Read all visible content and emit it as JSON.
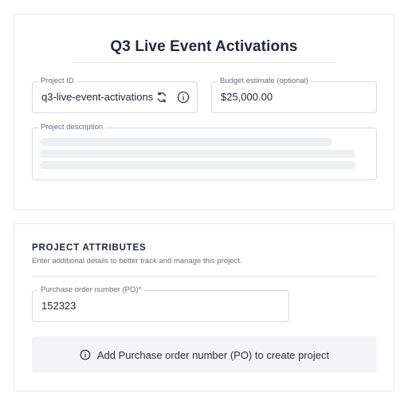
{
  "project": {
    "title": "Q3 Live Event Activations",
    "project_id": {
      "label": "Project ID",
      "value": "q3-live-event-activations",
      "icons": [
        "refresh-icon",
        "info-icon"
      ]
    },
    "budget": {
      "label": "Budget estimate (optional)",
      "value": "$25,000.00"
    },
    "description": {
      "label": "Project description",
      "state": "loading"
    }
  },
  "attributes": {
    "heading": "PROJECT ATTRIBUTES",
    "subtitle": "Enter additional details to better track and manage this project.",
    "po": {
      "label": "Purchase order number (PO)*",
      "value": "152323"
    },
    "notice": {
      "icon": "info-icon",
      "text": "Add Purchase order number (PO) to create project"
    }
  },
  "colors": {
    "text": "#262838",
    "muted": "#6b6e7b",
    "border": "#d8d9de",
    "skeleton": "#eeeff2",
    "notice_bg": "#f5f5f7"
  }
}
